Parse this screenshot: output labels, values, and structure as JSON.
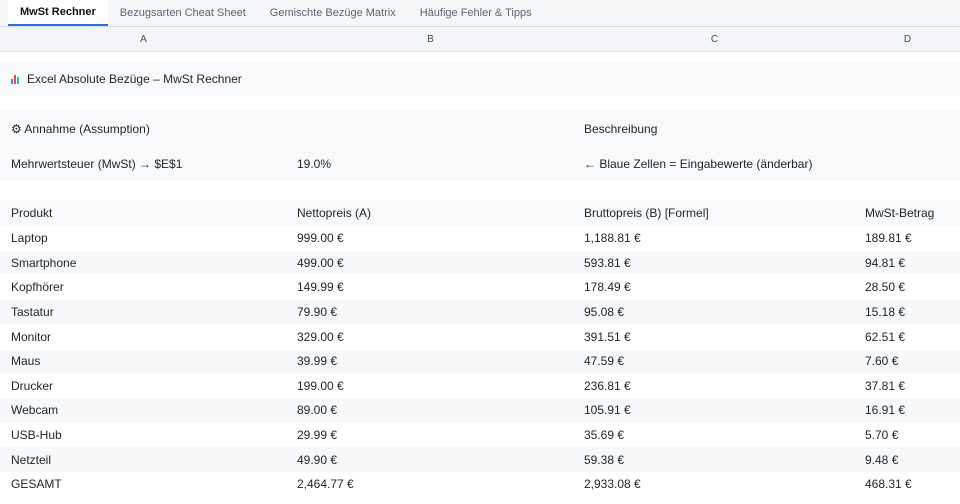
{
  "tabs": [
    {
      "label": "MwSt Rechner",
      "active": true
    },
    {
      "label": "Bezugsarten Cheat Sheet",
      "active": false
    },
    {
      "label": "Gemischte Bezüge Matrix",
      "active": false
    },
    {
      "label": "Häufige Fehler & Tipps",
      "active": false
    }
  ],
  "columns": [
    "A",
    "B",
    "C",
    "D"
  ],
  "sheet": {
    "title": "Excel Absolute Bezüge – MwSt Rechner",
    "title_icon": "bar-chart-icon",
    "assumption_label": "⚙ Annahme (Assumption)",
    "description_label": "Beschreibung",
    "vat_label": "Mehrwertsteuer (MwSt) → $E$1",
    "vat_value": "19.0%",
    "vat_note": "← Blaue Zellen = Eingabewerte (änderbar)",
    "table_headers": [
      "Produkt",
      "Nettopreis (A)",
      "Bruttopreis (B) [Formel]",
      "MwSt-Betrag"
    ],
    "rows": [
      [
        "Laptop",
        "999.00 €",
        "1,188.81 €",
        "189.81 €"
      ],
      [
        "Smartphone",
        "499.00 €",
        "593.81 €",
        "94.81 €"
      ],
      [
        "Kopfhörer",
        "149.99 €",
        "178.49 €",
        "28.50 €"
      ],
      [
        "Tastatur",
        "79.90 €",
        "95.08 €",
        "15.18 €"
      ],
      [
        "Monitor",
        "329.00 €",
        "391.51 €",
        "62.51 €"
      ],
      [
        "Maus",
        "39.99 €",
        "47.59 €",
        "7.60 €"
      ],
      [
        "Drucker",
        "199.00 €",
        "236.81 €",
        "37.81 €"
      ],
      [
        "Webcam",
        "89.00 €",
        "105.91 €",
        "16.91 €"
      ],
      [
        "USB-Hub",
        "29.99 €",
        "35.69 €",
        "5.70 €"
      ],
      [
        "Netzteil",
        "49.90 €",
        "59.38 €",
        "9.48 €"
      ]
    ],
    "total": [
      "GESAMT",
      "2,464.77 €",
      "2,933.08 €",
      "468.31 €"
    ]
  }
}
